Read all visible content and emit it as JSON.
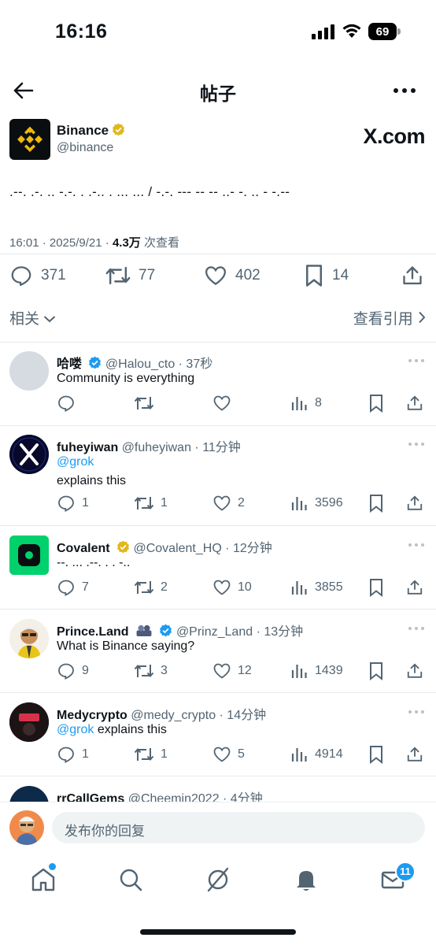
{
  "status_bar": {
    "time": "16:16",
    "battery": "69"
  },
  "header": {
    "title": "帖子"
  },
  "post": {
    "author_name": "Binance",
    "author_handle": "@binance",
    "brand_mark": "X.com",
    "text": ".--. .-. .. -.-. . .-.. . ... ... / -.-. --- -- -- ..- -. .. - -.--",
    "time": "16:01 · 2025/9/21 · ",
    "views": "4.3万",
    "views_suffix": " 次查看",
    "replies": "371",
    "reposts": "77",
    "likes": "402",
    "bookmarks": "14"
  },
  "related": {
    "left": "相关",
    "right": "查看引用"
  },
  "replies": [
    {
      "name": "哈喽",
      "handle": "@Halou_cto · 37秒",
      "text": "Community is everything",
      "reply": "",
      "repost": "",
      "like": "",
      "views": "8"
    },
    {
      "name": "fuheyiwan",
      "handle": "@fuheyiwan · 11分钟",
      "mention": "@grok",
      "text": "explains this",
      "reply": "1",
      "repost": "1",
      "like": "2",
      "views": "3596"
    },
    {
      "name": "Covalent",
      "handle": "@Covalent_HQ · 12分钟",
      "text": "--. ... .--. . . -..",
      "reply": "7",
      "repost": "2",
      "like": "10",
      "views": "3855"
    },
    {
      "name": "Prince.Land",
      "handle": "@Prinz_Land · 13分钟",
      "text": "What is Binance saying?",
      "reply": "9",
      "repost": "3",
      "like": "12",
      "views": "1439"
    },
    {
      "name": "Medycrypto",
      "handle": "@medy_crypto · 14分钟",
      "mention": "@grok",
      "text": " explains this",
      "reply": "1",
      "repost": "1",
      "like": "5",
      "views": "4914"
    },
    {
      "name": "rrCallGems",
      "handle": "@Cheemin2022 · 4分钟"
    }
  ],
  "compose": {
    "placeholder": "发布你的回复"
  },
  "tabbar": {
    "messages_badge": "11"
  },
  "colors": {
    "accent": "#1d9bf0",
    "verified_gold": "#e2b719",
    "binance_yellow": "#f0b90b",
    "covalent_green": "#00d16c"
  }
}
